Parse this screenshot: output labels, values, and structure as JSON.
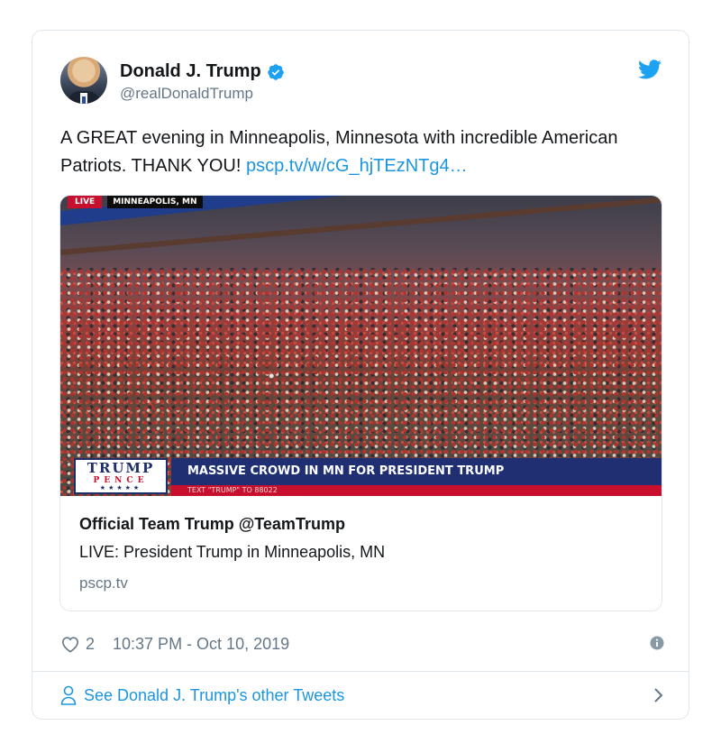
{
  "tweet": {
    "author_name": "Donald J. Trump",
    "handle": "@realDonaldTrump",
    "text": "A GREAT evening in Minneapolis, Minnesota with incredible American Patriots. THANK YOU! ",
    "link": "pscp.tv/w/cG_hjTEzNTg4…",
    "likes": "2",
    "timestamp": "10:37 PM - Oct 10, 2019"
  },
  "media": {
    "live_label": "LIVE",
    "location_label": "MINNEAPOLIS, MN",
    "logo_line1": "TRUMP",
    "logo_line2": "PENCE",
    "logo_line3": "★★★★★",
    "banner_headline": "MASSIVE CROWD IN MN FOR PRESIDENT TRUMP",
    "banner_sub": "TEXT \"TRUMP\" TO 88022"
  },
  "card": {
    "title": "Official Team Trump @TeamTrump",
    "description": "LIVE: President Trump in Minneapolis, MN",
    "domain": "pscp.tv"
  },
  "footer": {
    "see_more": "See Donald J. Trump's other Tweets"
  },
  "colors": {
    "link": "#1b95e0",
    "muted": "#657786",
    "border": "#e1e8ed"
  }
}
